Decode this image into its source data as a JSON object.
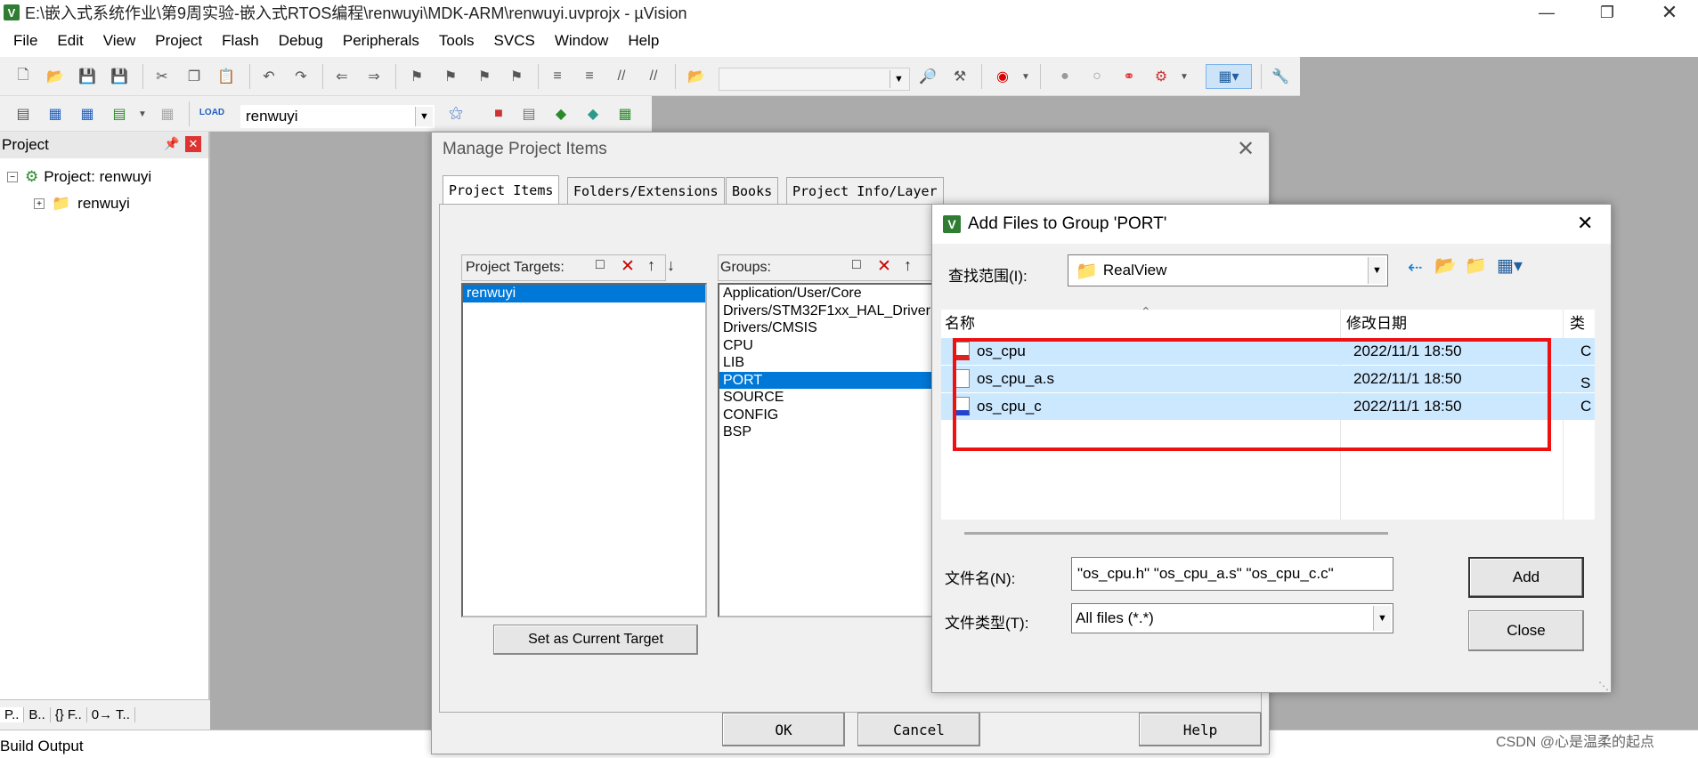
{
  "window": {
    "title": "E:\\嵌入式系统作业\\第9周实验-嵌入式RTOS编程\\renwuyi\\MDK-ARM\\renwuyi.uvprojx - µVision",
    "app_icon": "V"
  },
  "menu": [
    "File",
    "Edit",
    "View",
    "Project",
    "Flash",
    "Debug",
    "Peripherals",
    "Tools",
    "SVCS",
    "Window",
    "Help"
  ],
  "toolbar2": {
    "target": "renwuyi"
  },
  "project_panel": {
    "title": "Project",
    "tree": [
      {
        "label": "Project: renwuyi"
      },
      {
        "label": "renwuyi"
      }
    ],
    "tabs": [
      "P..",
      "B..",
      "{} F..",
      "0→ T.."
    ]
  },
  "build_output": "Build Output",
  "manage_dialog": {
    "title": "Manage Project Items",
    "tabs": [
      "Project Items",
      "Folders/Extensions",
      "Books",
      "Project Info/Layer"
    ],
    "targets_label": "Project Targets:",
    "targets": [
      "renwuyi"
    ],
    "groups_label": "Groups:",
    "groups": [
      "Application/User/Core",
      "Drivers/STM32F1xx_HAL_Driver",
      "Drivers/CMSIS",
      "CPU",
      "LIB",
      "PORT",
      "SOURCE",
      "CONFIG",
      "BSP"
    ],
    "selected_group": "PORT",
    "set_current_target": "Set as Current Target",
    "ok": "OK",
    "cancel": "Cancel",
    "help": "Help"
  },
  "add_files_dialog": {
    "title": "Add Files to Group 'PORT'",
    "look_in_label": "查找范围(I):",
    "look_in_value": "RealView",
    "columns": [
      "名称",
      "修改日期",
      "类"
    ],
    "files": [
      {
        "name": "os_cpu",
        "date": "2022/11/1 18:50",
        "type": "C I"
      },
      {
        "name": "os_cpu_a.s",
        "date": "2022/11/1 18:50",
        "type": "S 文"
      },
      {
        "name": "os_cpu_c",
        "date": "2022/11/1 18:50",
        "type": "C S"
      }
    ],
    "filename_label": "文件名(N):",
    "filename_value": "\"os_cpu.h\" \"os_cpu_a.s\" \"os_cpu_c.c\"",
    "filetype_label": "文件类型(T):",
    "filetype_value": "All files (*.*)",
    "add": "Add",
    "close": "Close"
  },
  "watermark": "CSDN @心是温柔的起点",
  "colors": {
    "selection": "#0078d7",
    "file_selection": "#cce8ff",
    "highlight_box": "#ee1111"
  }
}
